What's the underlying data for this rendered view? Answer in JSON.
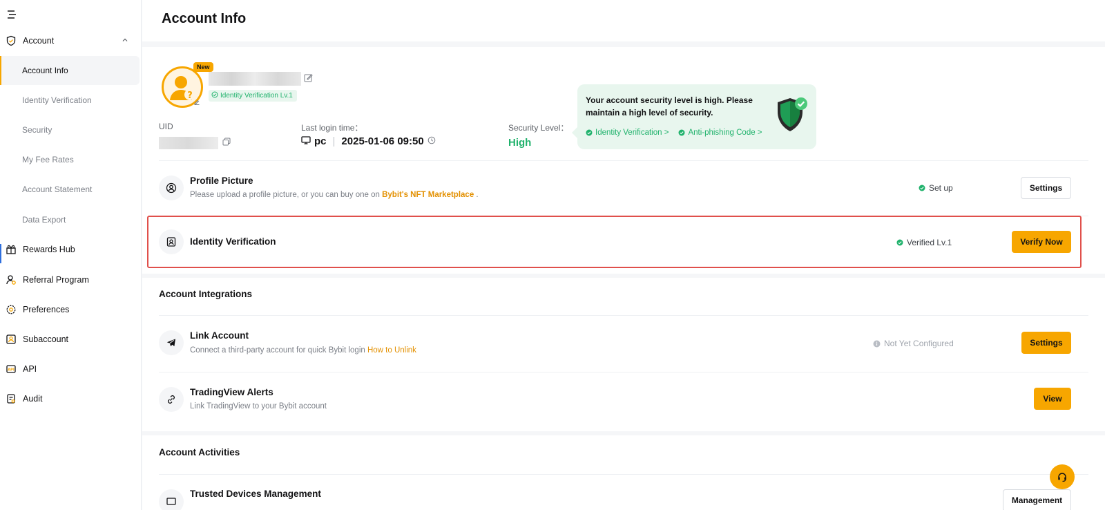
{
  "sidebar": {
    "items": [
      {
        "label": "Account",
        "icon": "shield-icon"
      },
      {
        "label": "Rewards Hub",
        "icon": "gift-icon"
      },
      {
        "label": "Referral Program",
        "icon": "referral-icon"
      },
      {
        "label": "Preferences",
        "icon": "gear-icon"
      },
      {
        "label": "Subaccount",
        "icon": "subaccount-icon"
      },
      {
        "label": "API",
        "icon": "api-icon"
      },
      {
        "label": "Audit",
        "icon": "audit-icon"
      }
    ],
    "sub_items": [
      {
        "label": "Account Info",
        "active": true
      },
      {
        "label": "Identity Verification"
      },
      {
        "label": "Security"
      },
      {
        "label": "My Fee Rates"
      },
      {
        "label": "Account Statement"
      },
      {
        "label": "Data Export"
      }
    ]
  },
  "header": {
    "title": "Account Info"
  },
  "profile": {
    "new_badge": "New",
    "idv_tag": "Identity Verification Lv.1",
    "uid_label": "UID",
    "last_login_label": "Last login time：",
    "device": "pc",
    "last_login_time": "2025-01-06 09:50",
    "security_label": "Security Level：",
    "security_value": "High"
  },
  "security_tip": {
    "text": "Your account security level is high. Please maintain a high level of security.",
    "links": [
      "Identity Verification >",
      "Anti-phishing Code >"
    ]
  },
  "rows": {
    "profile_picture": {
      "title": "Profile Picture",
      "desc": "Please upload a profile picture, or you can buy one on",
      "link": "Bybit's NFT Marketplace",
      "desc_end": ".",
      "status": "Set up",
      "button": "Settings"
    },
    "identity_verification": {
      "title": "Identity Verification",
      "status": "Verified Lv.1",
      "button": "Verify Now"
    }
  },
  "integrations": {
    "title": "Account Integrations",
    "link_account": {
      "title": "Link Account",
      "desc": "Connect a third-party account for quick Bybit login",
      "link": "How to Unlink",
      "status": "Not Yet Configured",
      "button": "Settings"
    },
    "tradingview": {
      "title": "TradingView Alerts",
      "desc": "Link TradingView to your Bybit account",
      "button": "View"
    }
  },
  "activities": {
    "title": "Account Activities",
    "trusted_devices": {
      "title": "Trusted Devices Management",
      "button": "Management"
    }
  },
  "colors": {
    "accent": "#f7a600",
    "success": "#20b26c",
    "highlight_border": "#e0504b"
  }
}
